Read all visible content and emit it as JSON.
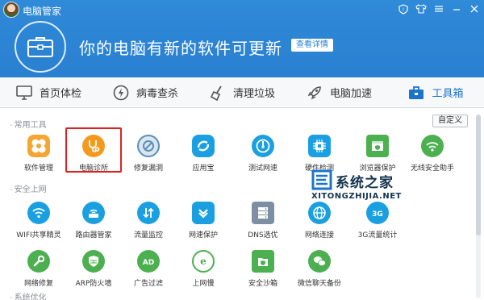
{
  "titlebar": {
    "title": "电脑管家"
  },
  "hero": {
    "message": "你的电脑有新的软件可更新",
    "details_button": "查看详情"
  },
  "tabs": [
    {
      "label": "首页体检",
      "icon": "monitor-icon"
    },
    {
      "label": "病毒查杀",
      "icon": "lightning-icon"
    },
    {
      "label": "清理垃圾",
      "icon": "broom-icon"
    },
    {
      "label": "电脑加速",
      "icon": "rocket-icon"
    },
    {
      "label": "工具箱",
      "icon": "toolbox-icon",
      "active": true
    }
  ],
  "sections": {
    "common": {
      "label": "常用工具",
      "custom_button": "自定义"
    },
    "security": {
      "label": "安全上网"
    },
    "system": {
      "label": "系统优化"
    }
  },
  "tools_row1": [
    {
      "label": "软件管理",
      "icon": "clover-icon",
      "color": "#f39a1e"
    },
    {
      "label": "电脑诊所",
      "icon": "stethoscope-icon",
      "color": "#f39a1e"
    },
    {
      "label": "修复漏洞",
      "icon": "patch-icon",
      "color": "#5a8fb8"
    },
    {
      "label": "应用宝",
      "icon": "app-store-icon",
      "color": "#1aa0e0"
    },
    {
      "label": "测试网速",
      "icon": "speedometer-icon",
      "color": "#1aa0e0"
    },
    {
      "label": "硬件检测",
      "icon": "chip-icon",
      "color": "#1aa0e0"
    },
    {
      "label": "浏览器保护",
      "icon": "browser-shield-icon",
      "color": "#4caf50"
    },
    {
      "label": "无线安全助手",
      "icon": "wifi-shield-icon",
      "color": "#4caf50"
    }
  ],
  "tools_row2": [
    {
      "label": "WIFI共享精灵",
      "icon": "wifi-icon",
      "color": "#1aa0e0"
    },
    {
      "label": "路由器管家",
      "icon": "router-icon",
      "color": "#1aa0e0"
    },
    {
      "label": "流量监控",
      "icon": "traffic-icon",
      "color": "#1aa0e0"
    },
    {
      "label": "网速保护",
      "icon": "speed-protect-icon",
      "color": "#1aa0e0"
    },
    {
      "label": "DNS选优",
      "icon": "dns-icon",
      "color": "#8a9bb0"
    },
    {
      "label": "网络连接",
      "icon": "globe-icon",
      "color": "#1aa0e0"
    },
    {
      "label": "3G流量统计",
      "icon": "3g-icon",
      "color": "#1aa0e0"
    }
  ],
  "tools_row3": [
    {
      "label": "网络修复",
      "icon": "wrench-icon",
      "color": "#4caf50"
    },
    {
      "label": "ARP防火墙",
      "icon": "firewall-icon",
      "color": "#4caf50"
    },
    {
      "label": "广告过滤",
      "icon": "ad-filter-icon",
      "color": "#4caf50"
    },
    {
      "label": "上网慢",
      "icon": "ie-slow-icon",
      "color": "#4caf50"
    },
    {
      "label": "安全沙箱",
      "icon": "sandbox-icon",
      "color": "#4caf50"
    },
    {
      "label": "微信聊天备份",
      "icon": "wechat-icon",
      "color": "#4caf50"
    }
  ],
  "watermark": {
    "title": "系统之家",
    "subtitle": "XITONGZHIJIA.NET"
  }
}
